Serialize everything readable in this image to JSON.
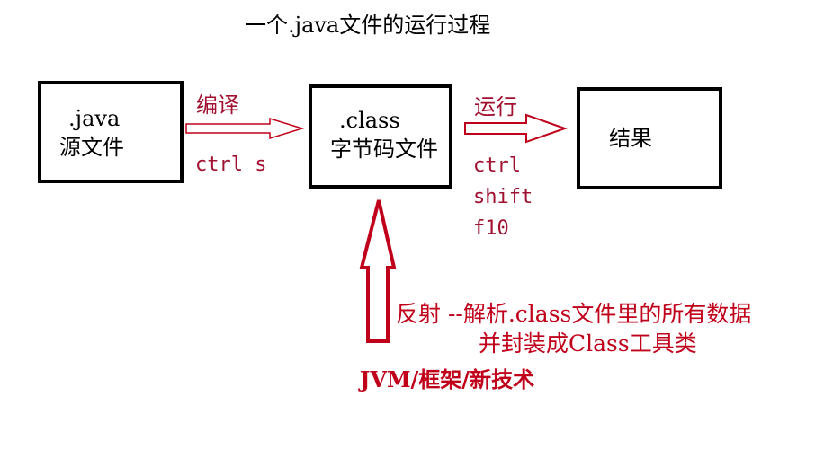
{
  "title": "一个.java文件的运行过程",
  "boxes": {
    "java": {
      "line1": ".java",
      "line2": "源文件"
    },
    "class": {
      "line1": ".class",
      "line2": "字节码文件"
    },
    "result": {
      "line1": "结果"
    }
  },
  "arrows": {
    "compile": {
      "label": "编译",
      "shortcut": "ctrl s"
    },
    "run": {
      "label": "运行",
      "shortcut": [
        "ctrl",
        "shift",
        "f10"
      ]
    }
  },
  "reflection": {
    "line1": "反射 --解析.class文件里的所有数据",
    "line2": "并封装成Class工具类",
    "footer": "JVM/框架/新技术"
  },
  "colors": {
    "arrow": "#c0001a",
    "box_border": "#000000",
    "label": "#a01030"
  }
}
